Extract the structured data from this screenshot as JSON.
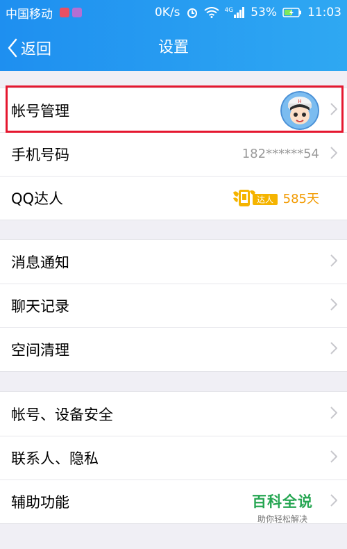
{
  "statusbar": {
    "carrier": "中国移动",
    "speed": "0K/s",
    "network": "4G",
    "battery": "53%",
    "time": "11:03"
  },
  "nav": {
    "back_label": "返回",
    "title": "设置"
  },
  "group1": [
    {
      "label": "帐号管理"
    },
    {
      "label": "手机号码",
      "value": "182******54"
    },
    {
      "label": "QQ达人",
      "badge_text": "达人",
      "value": "585天"
    }
  ],
  "group2": [
    {
      "label": "消息通知"
    },
    {
      "label": "聊天记录"
    },
    {
      "label": "空间清理"
    }
  ],
  "group3": [
    {
      "label": "帐号、设备安全"
    },
    {
      "label": "联系人、隐私"
    },
    {
      "label": "辅助功能"
    }
  ],
  "watermark": {
    "title": "百科全说",
    "subtitle": "助你轻松解决"
  },
  "colors": {
    "accent": "#1e8ff0",
    "highlight": "#e5172f",
    "qq_days": "#f29a00",
    "watermark": "#26a652"
  }
}
